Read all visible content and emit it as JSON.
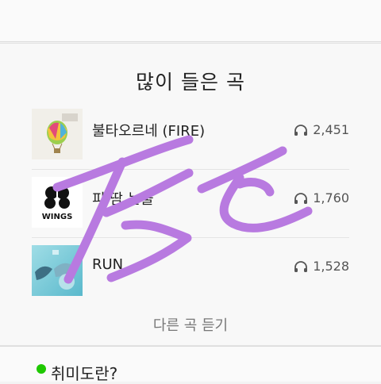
{
  "section": {
    "title": "많이 들은 곡"
  },
  "songs": [
    {
      "title": "불타오르네 (FIRE)",
      "count": "2,451",
      "art": "young-forever-icon"
    },
    {
      "title": "피 땀 눈물",
      "count": "1,760",
      "art": "wings-icon"
    },
    {
      "title": "RUN",
      "count": "1,528",
      "art": "hyyh-pt2-icon"
    }
  ],
  "wings_text": "WINGS",
  "more": {
    "label": "다른 곡 듣기"
  },
  "bottom": {
    "label": "취미도란?"
  },
  "scribble_color": "#b87ae0",
  "accent_green": "#1ec800"
}
